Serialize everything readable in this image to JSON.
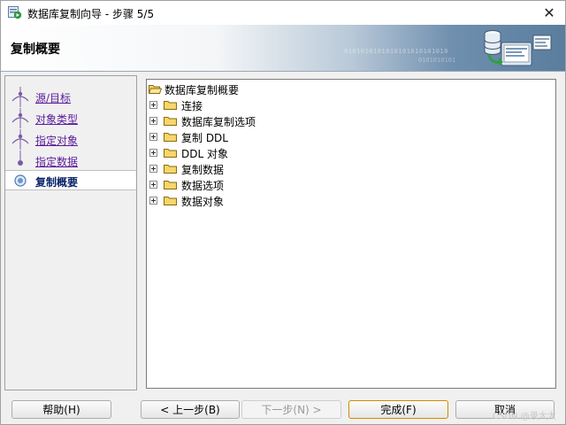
{
  "window": {
    "title": "数据库复制向导 - 步骤 5/5",
    "close_glyph": "✕"
  },
  "banner": {
    "title": "复制概要",
    "binary_text": "0101010101010101010101010",
    "binary_text2": "0101010101"
  },
  "steps": [
    {
      "label": "源/目标",
      "state": "done"
    },
    {
      "label": "对象类型",
      "state": "done"
    },
    {
      "label": "指定对象",
      "state": "done"
    },
    {
      "label": "指定数据",
      "state": "done"
    },
    {
      "label": "复制概要",
      "state": "current"
    }
  ],
  "tree": {
    "root": {
      "label": "数据库复制概要",
      "icon": "open-folder-icon"
    },
    "children": [
      {
        "label": "连接",
        "icon": "folder-icon"
      },
      {
        "label": "数据库复制选项",
        "icon": "folder-icon"
      },
      {
        "label": "复制 DDL",
        "icon": "folder-icon"
      },
      {
        "label": "DDL 对象",
        "icon": "folder-icon"
      },
      {
        "label": "复制数据",
        "icon": "folder-icon"
      },
      {
        "label": "数据选项",
        "icon": "folder-icon"
      },
      {
        "label": "数据对象",
        "icon": "folder-icon"
      }
    ]
  },
  "buttons": {
    "help": "帮助(H)",
    "back": "< 上一步(B)",
    "next": "下一步(N) >",
    "finish": "完成(F)",
    "cancel": "取消"
  },
  "watermark": "CSDN @录大大",
  "colors": {
    "link_visited": "#5a1a9a",
    "current_step": "#0a246a",
    "banner_blue": "#5a7d9e",
    "step_marker": "#7a5aa8"
  }
}
